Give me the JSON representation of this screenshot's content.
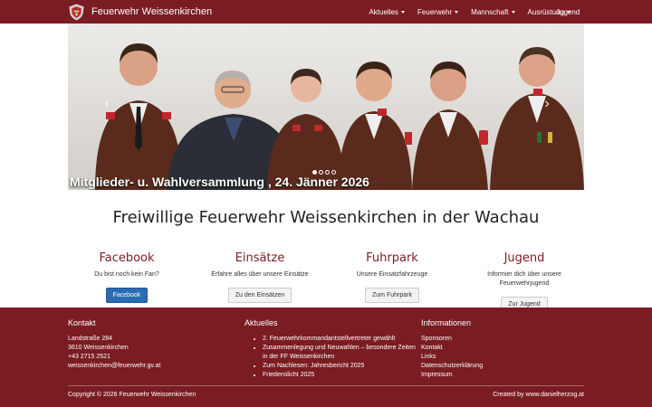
{
  "colors": {
    "brand": "#7a1c22",
    "primary_button": "#2a6cb3"
  },
  "navbar": {
    "brand": "Feuerwehr Weissenkirchen",
    "logo": "fire-department-shield-logo",
    "items": [
      {
        "label": "Aktuelles",
        "dropdown": true
      },
      {
        "label": "Feuerwehr",
        "dropdown": true
      },
      {
        "label": "Mannschaft",
        "dropdown": true
      },
      {
        "label": "Ausrüstung",
        "dropdown": true
      }
    ],
    "jugend": "Jugend"
  },
  "carousel": {
    "caption": "Mitglieder- u. Wahlversammlung , 24. Jänner 2026",
    "prev_icon": "chevron-left-icon",
    "next_icon": "chevron-right-icon",
    "slides_count": 4,
    "active_slide": 1
  },
  "headline": "Freiwillige Feuerwehr Weissenkirchen in der Wachau",
  "features": [
    {
      "title": "Facebook",
      "text": "Du bist noch kein Fan?",
      "button": "Facebook",
      "style": "primary"
    },
    {
      "title": "Einsätze",
      "text": "Erfahre alles über unsere Einsätze",
      "button": "Zu den Einsätzen",
      "style": "default"
    },
    {
      "title": "Fuhrpark",
      "text": "Unsere Einsatzfahrzeuge",
      "button": "Zum Fuhrpark",
      "style": "default"
    },
    {
      "title": "Jugend",
      "text_lines": [
        "Informier dich über unsere",
        "Feuerwehrjugend"
      ],
      "button": "Zur Jugend",
      "style": "default"
    }
  ],
  "footer": {
    "kontakt": {
      "title": "Kontakt",
      "lines": [
        "Landstraße 284",
        "3610 Weissenkirchen",
        "+43 2715 2521",
        "weissenkirchen@feuerwehr.gv.at"
      ]
    },
    "aktuelles": {
      "title": "Aktuelles",
      "items": [
        "2. Feuerwehrkommandantstellvertreter gewählt",
        "Zusammenlegung und Neuwahlen – besondere Zeiten in der FF Weissenkirchen",
        "Zum Nachlesen: Jahresbericht 2025",
        "Friedenslicht 2025"
      ]
    },
    "informationen": {
      "title": "Informationen",
      "links": [
        "Sponsoren",
        "Kontakt",
        "Links",
        "Datenschutzerklärung",
        "Impressum"
      ]
    },
    "copyright": "Copyright © 2026 Feuerwehr Weissenkirchen",
    "credit": "Created by www.danielherzog.at"
  }
}
